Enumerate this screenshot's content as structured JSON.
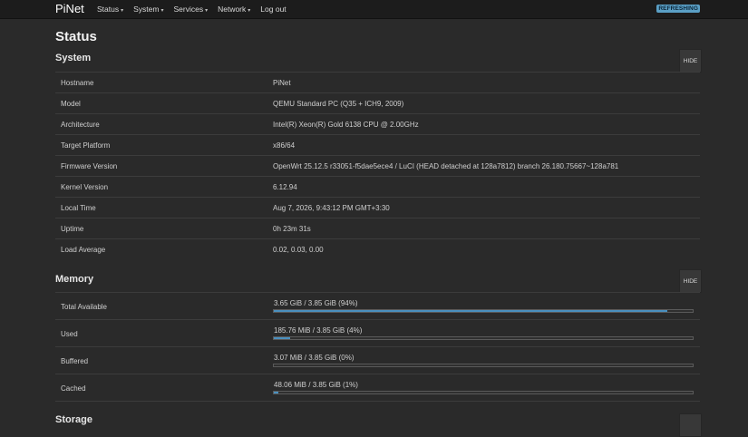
{
  "navbar": {
    "brand": "PiNet",
    "menu": [
      {
        "label": "Status",
        "has_dropdown": true
      },
      {
        "label": "System",
        "has_dropdown": true
      },
      {
        "label": "Services",
        "has_dropdown": true
      },
      {
        "label": "Network",
        "has_dropdown": true
      },
      {
        "label": "Log out",
        "has_dropdown": false
      }
    ],
    "indicator": "REFRESHING",
    "caret_glyph": "▾"
  },
  "page": {
    "title": "Status"
  },
  "system": {
    "title": "System",
    "hide_label": "HIDE",
    "rows": [
      {
        "label": "Hostname",
        "value": "PiNet"
      },
      {
        "label": "Model",
        "value": "QEMU Standard PC (Q35 + ICH9, 2009)"
      },
      {
        "label": "Architecture",
        "value": "Intel(R) Xeon(R) Gold 6138 CPU @ 2.00GHz"
      },
      {
        "label": "Target Platform",
        "value": "x86/64"
      },
      {
        "label": "Firmware Version",
        "value": "OpenWrt 25.12.5 r33051-f5dae5ece4 / LuCI (HEAD detached at 128a7812) branch 26.180.75667~128a781"
      },
      {
        "label": "Kernel Version",
        "value": "6.12.94"
      },
      {
        "label": "Local Time",
        "value": "Aug 7, 2026, 9:43:12 PM GMT+3:30"
      },
      {
        "label": "Uptime",
        "value": "0h 23m 31s"
      },
      {
        "label": "Load Average",
        "value": "0.02, 0.03, 0.00"
      }
    ]
  },
  "memory": {
    "title": "Memory",
    "hide_label": "HIDE",
    "rows": [
      {
        "label": "Total Available",
        "text": "3.65 GiB / 3.85 GiB (94%)",
        "percent": 94
      },
      {
        "label": "Used",
        "text": "185.76 MiB / 3.85 GiB (4%)",
        "percent": 4
      },
      {
        "label": "Buffered",
        "text": "3.07 MiB / 3.85 GiB (0%)",
        "percent": 0
      },
      {
        "label": "Cached",
        "text": "48.06 MiB / 3.85 GiB (1%)",
        "percent": 1
      }
    ]
  },
  "next_section": {
    "title": "Storage"
  },
  "colors": {
    "background": "#2a2a2a",
    "navbar": "#1c1c1c",
    "accent": "#4a90bf",
    "badge": "#5a9fc5"
  }
}
